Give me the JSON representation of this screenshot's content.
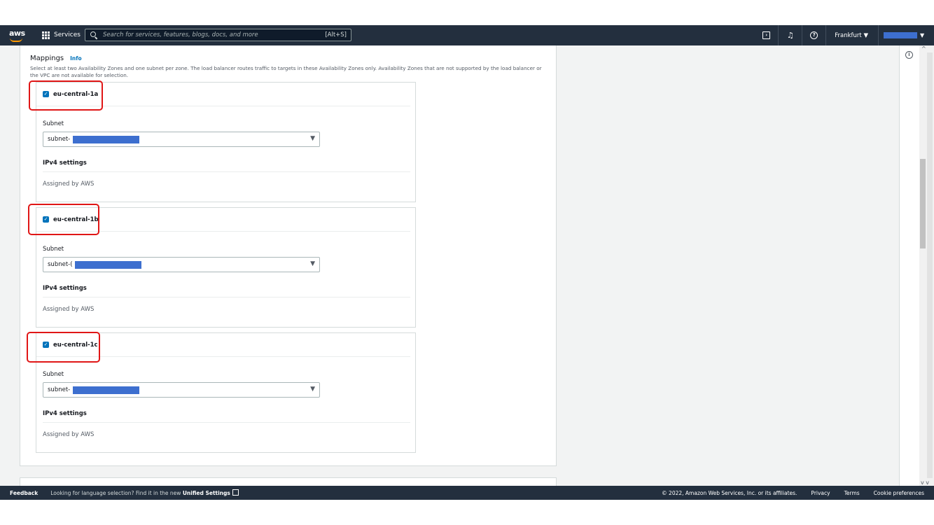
{
  "nav": {
    "logo": "aws",
    "services_label": "Services",
    "search_placeholder": "Search for services, features, blogs, docs, and more",
    "search_shortcut": "[Alt+S]",
    "region": "Frankfurt",
    "region_caret": "▼",
    "account_caret": "▼",
    "icons": [
      "cloudshell-icon",
      "bell-icon",
      "help-icon"
    ]
  },
  "mappings": {
    "title": "Mappings",
    "info": "Info",
    "description": "Select at least two Availability Zones and one subnet per zone. The load balancer routes traffic to targets in these Availability Zones only. Availability Zones that are not supported by the load balancer or the VPC are not available for selection."
  },
  "zones": [
    {
      "name": "eu-central-1a",
      "checked": true,
      "subnet_label": "Subnet",
      "subnet_value": "subnet-",
      "ipv4_title": "IPv4 settings",
      "ipv4_value": "Assigned by AWS"
    },
    {
      "name": "eu-central-1b",
      "checked": true,
      "subnet_label": "Subnet",
      "subnet_value": "subnet-(",
      "ipv4_title": "IPv4 settings",
      "ipv4_value": "Assigned by AWS"
    },
    {
      "name": "eu-central-1c",
      "checked": true,
      "subnet_label": "Subnet",
      "subnet_value": "subnet-",
      "ipv4_title": "IPv4 settings",
      "ipv4_value": "Assigned by AWS"
    }
  ],
  "footer": {
    "feedback": "Feedback",
    "lang_note": "Looking for language selection? Find it in the new",
    "unified_settings": "Unified Settings",
    "copyright": "© 2022, Amazon Web Services, Inc. or its affiliates.",
    "privacy": "Privacy",
    "terms": "Terms",
    "cookies": "Cookie preferences"
  },
  "colors": {
    "nav_bg": "#232f3e",
    "accent": "#0073bb",
    "highlight": "#e01616",
    "redaction": "#3d6fcf"
  }
}
